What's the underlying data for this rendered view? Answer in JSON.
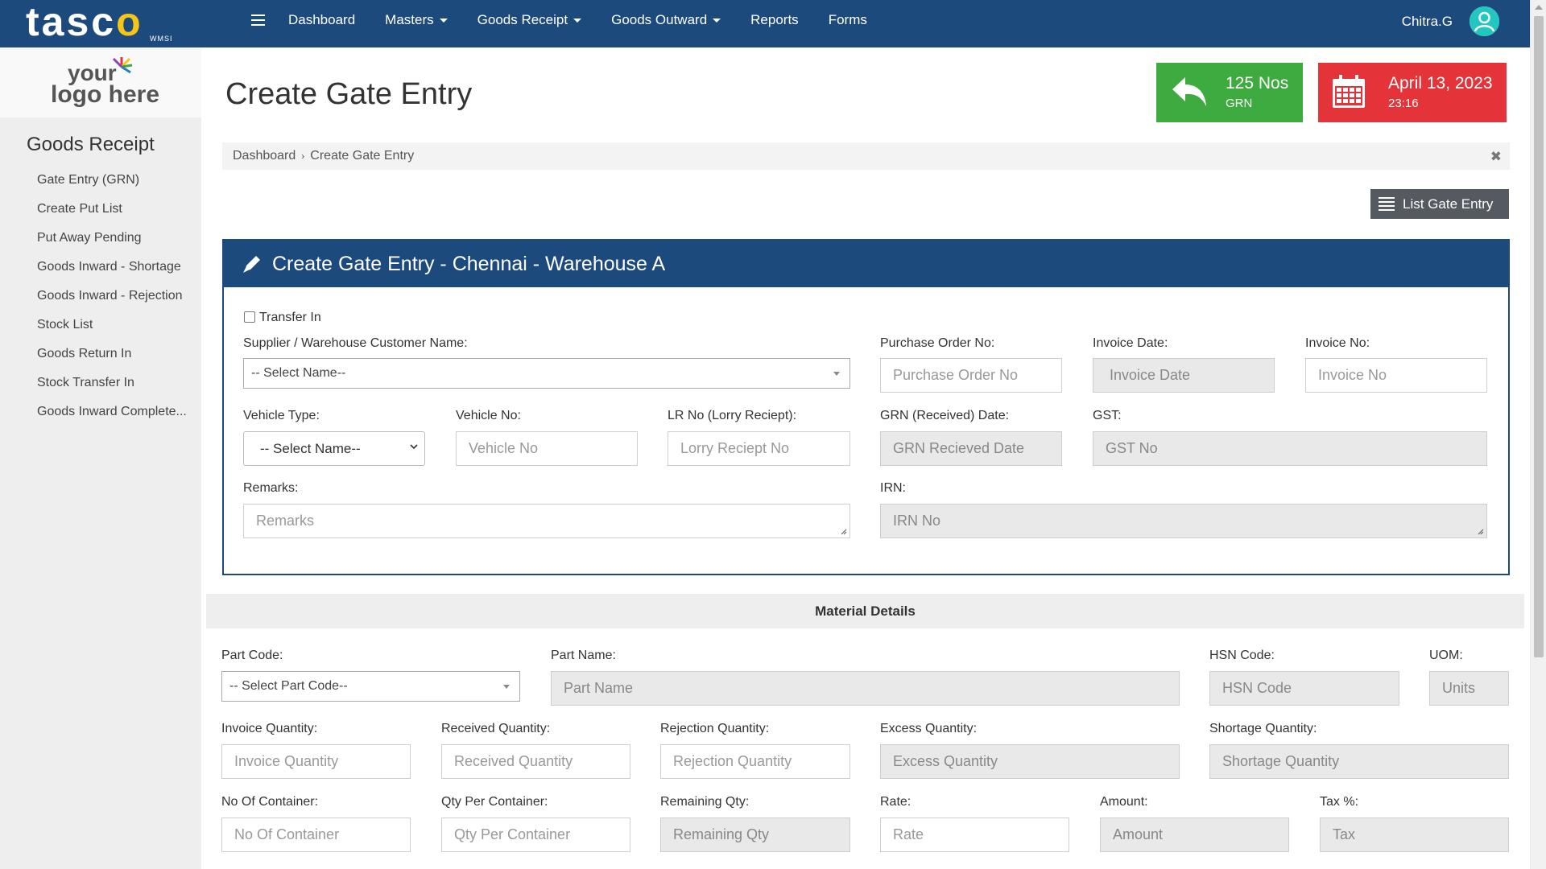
{
  "brand": {
    "name_pre": "tasc",
    "name_o": "o",
    "sub": "WMSI"
  },
  "nav": {
    "items": [
      {
        "label": "Dashboard",
        "dropdown": false
      },
      {
        "label": "Masters",
        "dropdown": true
      },
      {
        "label": "Goods Receipt",
        "dropdown": true
      },
      {
        "label": "Goods Outward",
        "dropdown": true
      },
      {
        "label": "Reports",
        "dropdown": false
      },
      {
        "label": "Forms",
        "dropdown": false
      }
    ],
    "user": "Chitra.G"
  },
  "sidebar": {
    "logo_line1": "your",
    "logo_line2": "logo here",
    "title": "Goods Receipt",
    "items": [
      "Gate Entry (GRN)",
      "Create Put List",
      "Put Away Pending",
      "Goods Inward - Shortage",
      "Goods Inward - Rejection",
      "Stock List",
      "Goods Return In",
      "Stock Transfer In",
      "Goods Inward Complete..."
    ]
  },
  "page": {
    "title": "Create Gate Entry",
    "stat_green": {
      "main": "125 Nos",
      "sub": "GRN",
      "icon": "reply-arrow-icon"
    },
    "stat_red": {
      "main": "April 13, 2023",
      "sub": "23:16",
      "icon": "calendar-icon"
    },
    "breadcrumb": {
      "root": "Dashboard",
      "current": "Create Gate Entry",
      "close": "✖"
    },
    "list_button": "List Gate Entry"
  },
  "form": {
    "heading": "Create Gate Entry - Chennai - Warehouse A",
    "transfer_in": "Transfer In",
    "supplier_label": "Supplier / Warehouse Customer Name:",
    "supplier_value": "-- Select Name--",
    "po_label": "Purchase Order No:",
    "po_placeholder": "Purchase Order No",
    "invoice_date_label": "Invoice Date:",
    "invoice_date_placeholder": "Invoice Date",
    "invoice_no_label": "Invoice No:",
    "invoice_no_placeholder": "Invoice No",
    "vehicle_type_label": "Vehicle Type:",
    "vehicle_type_value": "-- Select Name--",
    "vehicle_no_label": "Vehicle No:",
    "vehicle_no_placeholder": "Vehicle No",
    "lr_label": "LR No (Lorry Reciept):",
    "lr_placeholder": "Lorry Reciept No",
    "grn_date_label": "GRN (Received) Date:",
    "grn_date_placeholder": "GRN Recieved Date",
    "gst_label": "GST:",
    "gst_placeholder": "GST No",
    "remarks_label": "Remarks:",
    "remarks_placeholder": "Remarks",
    "irn_label": "IRN:",
    "irn_placeholder": "IRN No"
  },
  "material": {
    "heading": "Material Details",
    "part_code_label": "Part Code:",
    "part_code_value": "-- Select Part Code--",
    "part_name_label": "Part Name:",
    "part_name_placeholder": "Part Name",
    "hsn_label": "HSN Code:",
    "hsn_placeholder": "HSN Code",
    "uom_label": "UOM:",
    "uom_placeholder": "Units",
    "invoice_qty_label": "Invoice Quantity:",
    "invoice_qty_placeholder": "Invoice Quantity",
    "received_qty_label": "Received Quantity:",
    "received_qty_placeholder": "Received Quantity",
    "rejection_qty_label": "Rejection Quantity:",
    "rejection_qty_placeholder": "Rejection Quantity",
    "excess_qty_label": "Excess Quantity:",
    "excess_qty_placeholder": "Excess Quantity",
    "shortage_qty_label": "Shortage Quantity:",
    "shortage_qty_placeholder": "Shortage Quantity",
    "containers_label": "No Of Container:",
    "containers_placeholder": "No Of Container",
    "qty_per_container_label": "Qty Per Container:",
    "qty_per_container_placeholder": "Qty Per Container",
    "remaining_label": "Remaining Qty:",
    "remaining_placeholder": "Remaining Qty",
    "rate_label": "Rate:",
    "rate_placeholder": "Rate",
    "amount_label": "Amount:",
    "amount_placeholder": "Amount",
    "tax_label": "Tax %:",
    "tax_placeholder": "Tax"
  },
  "colors": {
    "primary": "#1d4a7d",
    "green": "#3dab3f",
    "red": "#e4343a",
    "accent": "#f5c518"
  }
}
